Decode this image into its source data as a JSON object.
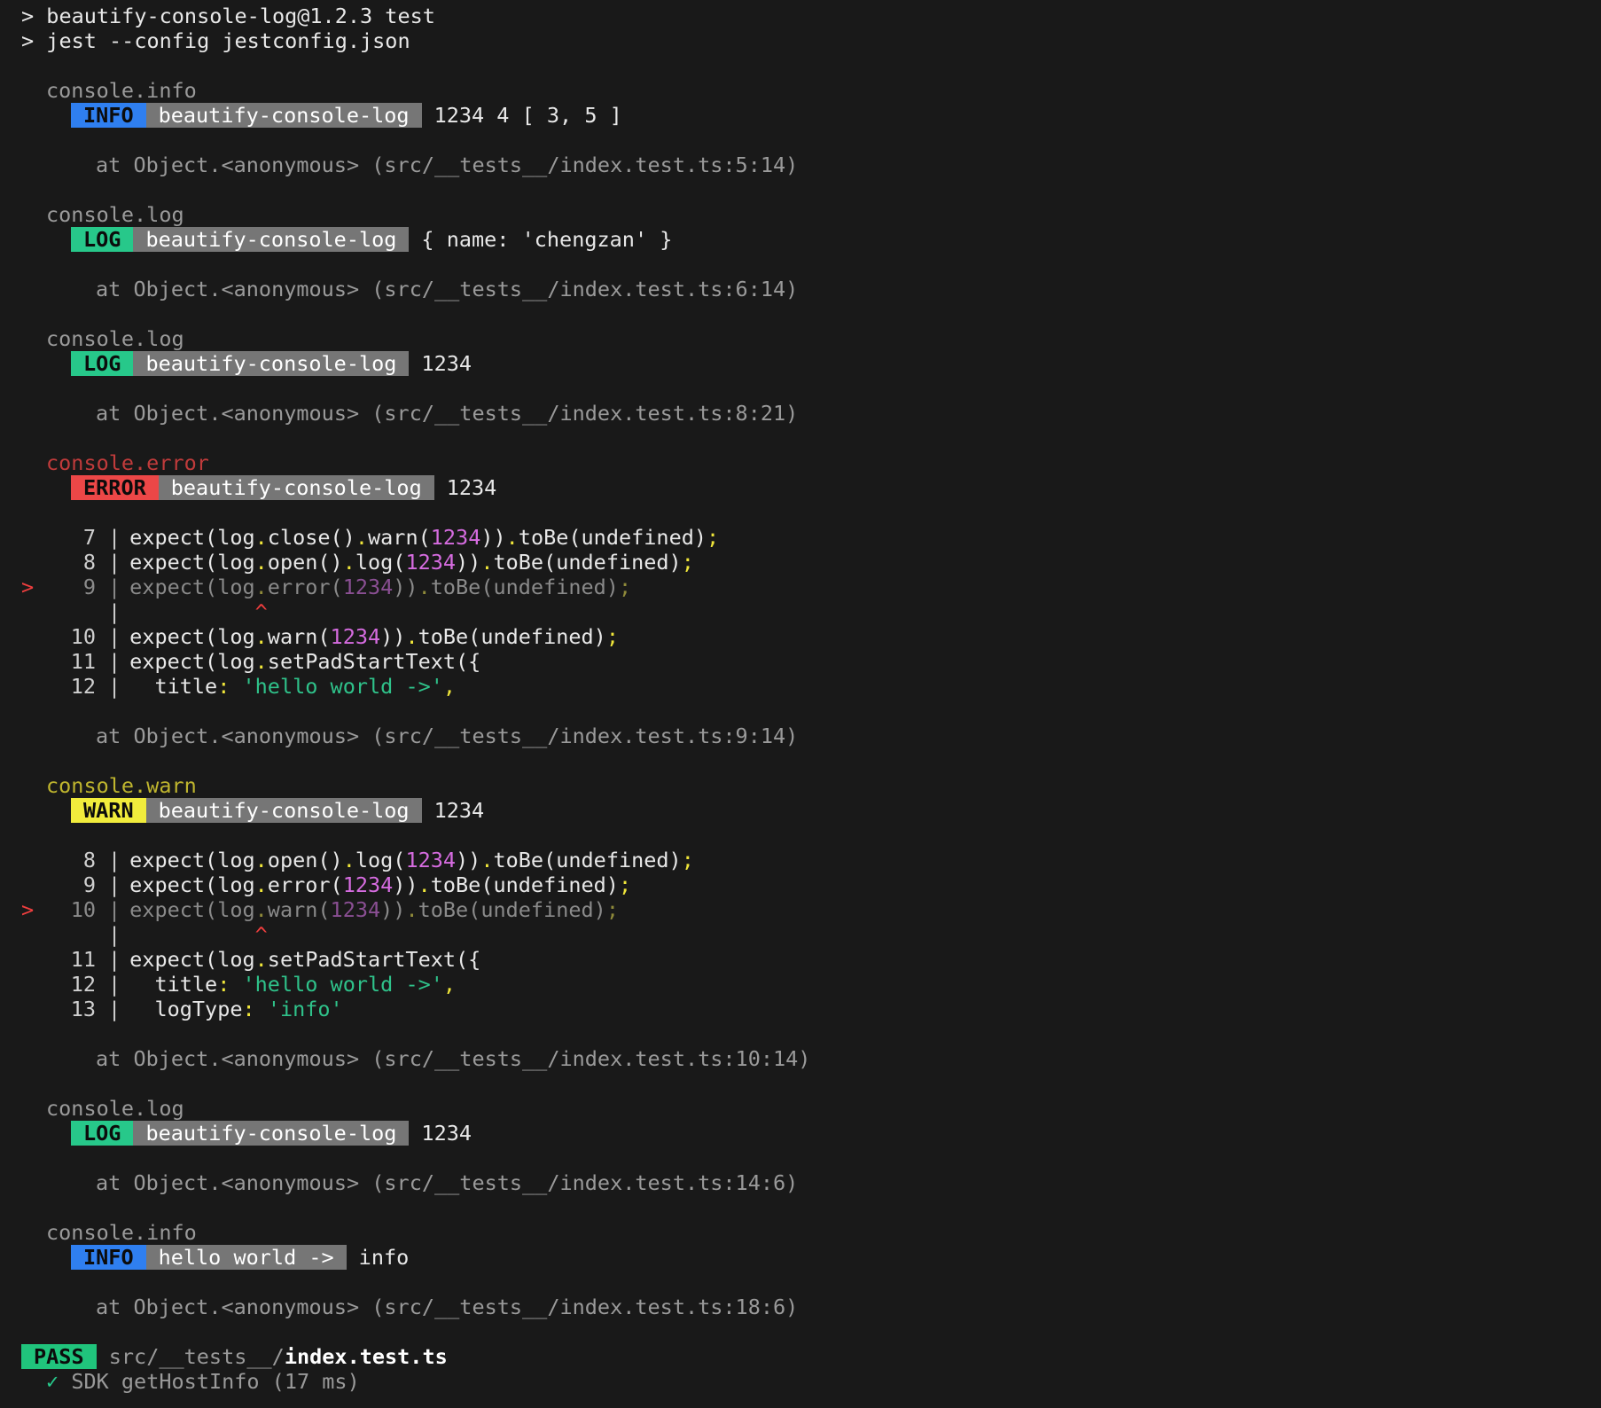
{
  "header": {
    "line1": "> beautify-console-log@1.2.3 test",
    "line2": "> jest --config jestconfig.json"
  },
  "entries": [
    {
      "label": "console.info",
      "badge": "INFO",
      "tag": "beautify-console-log",
      "message": "1234 4 [ 3, 5 ]",
      "at": "at Object.<anonymous> (src/__tests__/index.test.ts:5:14)"
    },
    {
      "label": "console.log",
      "badge": "LOG",
      "tag": "beautify-console-log",
      "message": "{ name: 'chengzan' }",
      "at": "at Object.<anonymous> (src/__tests__/index.test.ts:6:14)"
    },
    {
      "label": "console.log",
      "badge": "LOG",
      "tag": "beautify-console-log",
      "message": "1234",
      "at": "at Object.<anonymous> (src/__tests__/index.test.ts:8:21)"
    },
    {
      "label": "console.error",
      "badge": "ERROR",
      "tag": "beautify-console-log",
      "message": "1234",
      "at": "at Object.<anonymous> (src/__tests__/index.test.ts:9:14)",
      "code": {
        "l7": "7",
        "l8": "8",
        "l9": "9",
        "l10": "10",
        "l11": "11",
        "l12": "12",
        "marker": ">",
        "caret": "^"
      }
    },
    {
      "label": "console.warn",
      "badge": "WARN",
      "tag": "beautify-console-log",
      "message": "1234",
      "at": "at Object.<anonymous> (src/__tests__/index.test.ts:10:14)",
      "code": {
        "l8": "8",
        "l9": "9",
        "l10": "10",
        "l11": "11",
        "l12": "12",
        "l13": "13",
        "marker": ">",
        "caret": "^"
      }
    },
    {
      "label": "console.log",
      "badge": "LOG",
      "tag": "beautify-console-log",
      "message": "1234",
      "at": "at Object.<anonymous> (src/__tests__/index.test.ts:14:6)"
    },
    {
      "label": "console.info",
      "badge": "INFO",
      "tag": "hello world ->",
      "message": "info",
      "at": "at Object.<anonymous> (src/__tests__/index.test.ts:18:6)"
    }
  ],
  "result": {
    "badge": "PASS",
    "path_dir": "src/__tests__/",
    "path_file": "index.test.ts",
    "check": "✓",
    "test": "SDK getHostInfo (17 ms)"
  },
  "colors": {
    "background": "#191919",
    "info": "#2f7ff0",
    "log": "#27c88a",
    "error": "#ec4747",
    "warn": "#f1ec3c",
    "number": "#d66ce0",
    "string": "#2fc28a"
  }
}
